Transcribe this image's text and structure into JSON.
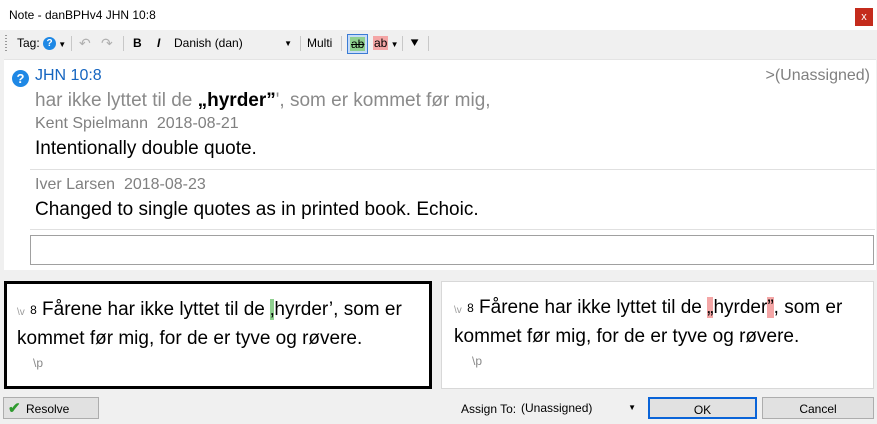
{
  "window": {
    "title": "Note - danBPHv4 JHN 10:8",
    "close_label": "x"
  },
  "toolbar": {
    "tag_label": "Tag:",
    "tag_icon": "question-icon",
    "bold_label": "B",
    "italic_label": "I",
    "language_value": "Danish (dan)",
    "multi_label": "Multi",
    "diff_label_1": "ab",
    "diff_label_2": "ab"
  },
  "note": {
    "reference": "JHN 10:8",
    "assigned": ">(Unassigned)",
    "context_before": "har ikke lyttet til de ",
    "context_bold": "„hyrder”",
    "context_mid": "'",
    "context_after": ", som er kommet før mig,",
    "comments": [
      {
        "author": "Kent Spielmann",
        "date": "2018-08-21",
        "text": "Intentionally double quote."
      },
      {
        "author": "Iver Larsen",
        "date": "2018-08-23",
        "text": "Changed to single quotes as in printed book. Echoic."
      }
    ],
    "reply_placeholder": ""
  },
  "panels": {
    "left": {
      "verse_marker": "\\v",
      "verse_number": "8",
      "text_before": " Fårene har ikke lyttet til de ",
      "highlight": "‚",
      "text_after": "hyrder’, som er kommet før mig, for de er tyve og røvere.",
      "paragraph_marker": "\\p"
    },
    "right": {
      "verse_marker": "\\v",
      "verse_number": "8",
      "text_before": " Fårene har ikke lyttet til de ",
      "highlight_1": "„",
      "text_mid": "hyrder",
      "highlight_2": "”",
      "text_after": ", som er kommet før mig, for de er tyve og røvere.",
      "paragraph_marker": "\\p"
    }
  },
  "footer": {
    "resolve_label": "Resolve",
    "assign_label": "Assign To:",
    "assign_value": "(Unassigned)",
    "ok_label": "OK",
    "cancel_label": "Cancel"
  },
  "colors": {
    "accent": "#1565c0",
    "insert_highlight": "#8fd08f",
    "delete_highlight": "#f4a6a6",
    "close": "#c42b1c"
  }
}
